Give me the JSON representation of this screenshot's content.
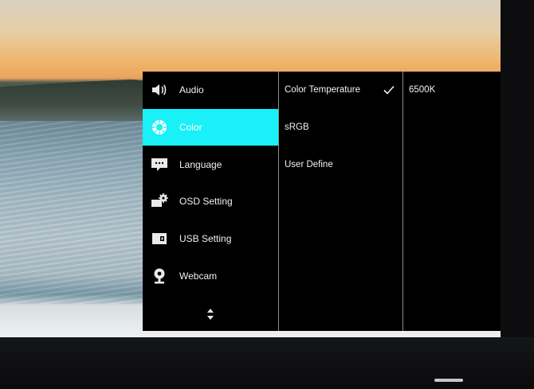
{
  "menu": {
    "items": [
      {
        "label": "Audio",
        "icon": "speaker-icon"
      },
      {
        "label": "Color",
        "icon": "color-wheel-icon",
        "active": true
      },
      {
        "label": "Language",
        "icon": "speech-bubble-icon"
      },
      {
        "label": "OSD Setting",
        "icon": "osd-gear-icon"
      },
      {
        "label": "USB Setting",
        "icon": "usb-port-icon"
      },
      {
        "label": "Webcam",
        "icon": "webcam-icon"
      }
    ],
    "scroll_icon": "up-down-arrows-icon",
    "active_color": "#19f0f7"
  },
  "submenu": {
    "items": [
      {
        "label": "Color Temperature",
        "selected": true
      },
      {
        "label": "sRGB"
      },
      {
        "label": "User Define"
      }
    ]
  },
  "values": {
    "current": "6500K"
  }
}
